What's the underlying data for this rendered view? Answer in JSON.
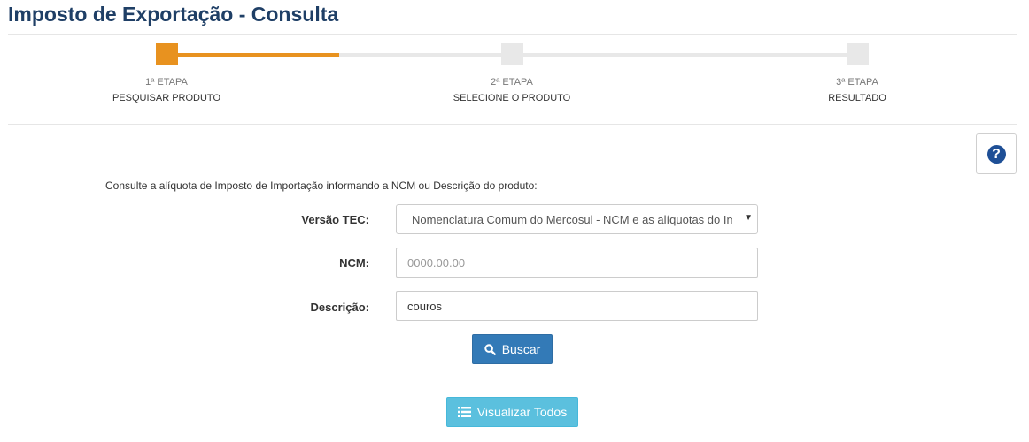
{
  "page": {
    "title": "Imposto de Exportação - Consulta"
  },
  "stepper": {
    "progress": 0.25,
    "steps": [
      {
        "label": "1ª ETAPA",
        "name": "PESQUISAR PRODUTO",
        "state": "active"
      },
      {
        "label": "2ª ETAPA",
        "name": "SELECIONE O PRODUTO",
        "state": "pending"
      },
      {
        "label": "3ª ETAPA",
        "name": "RESULTADO",
        "state": "pending"
      }
    ],
    "colors": {
      "active": "#e8921f",
      "inactive": "#e8e8e8"
    }
  },
  "help": {
    "icon": "question-circle-icon",
    "glyph": "?"
  },
  "form": {
    "intro": "Consulte a alíquota de Imposto de Importação informando a NCM ou Descrição do produto:",
    "versao_tec": {
      "label": "Versão TEC:",
      "selected": "Nomenclatura Comum do Mercosul - NCM e as alíquotas do Imposto de Importação"
    },
    "ncm": {
      "label": "NCM:",
      "value": "",
      "placeholder": "0000.00.00"
    },
    "descricao": {
      "label": "Descrição:",
      "value": "couros",
      "placeholder": ""
    }
  },
  "buttons": {
    "search": {
      "label": "Buscar",
      "icon": "search-icon",
      "color": "#337ab7"
    },
    "view_all": {
      "label": "Visualizar Todos",
      "icon": "list-icon",
      "color": "#5bc0de"
    }
  }
}
